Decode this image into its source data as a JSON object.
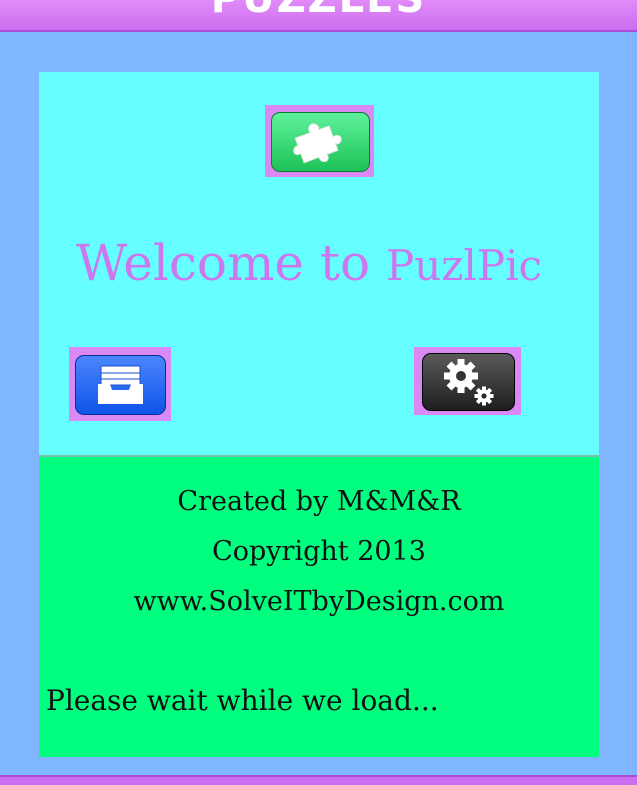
{
  "header": {
    "title": "PUZZLES"
  },
  "welcome": {
    "prefix": "Welcome to ",
    "brand": "PuzlPic"
  },
  "buttons": {
    "puzzle": {
      "icon": "puzzle-piece-icon"
    },
    "archive": {
      "icon": "inbox-tray-icon"
    },
    "settings": {
      "icon": "gears-icon"
    }
  },
  "credits": {
    "line1": "Created by M&M&R",
    "line2": "Copyright 2013",
    "line3": "www.SolveITbyDesign.com"
  },
  "status": {
    "loading": "Please wait while we load..."
  },
  "colors": {
    "background": "#7fb6ff",
    "header": "#cc6ef0",
    "top_panel": "#66ffff",
    "bottom_panel": "#00ff7f",
    "welcome_text": "#cc77ee"
  }
}
